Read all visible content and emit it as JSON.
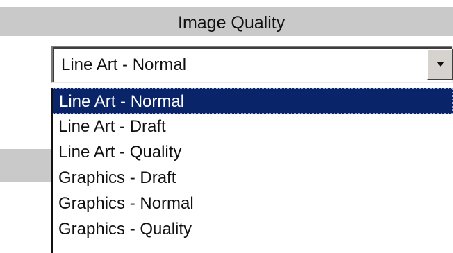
{
  "section": {
    "title": "Image Quality"
  },
  "select": {
    "value": "Line Art - Normal",
    "arrow_icon": "triangle-down-icon",
    "options": [
      {
        "label": "Line Art - Normal",
        "selected": true
      },
      {
        "label": "Line Art - Draft",
        "selected": false
      },
      {
        "label": "Line Art - Quality",
        "selected": false
      },
      {
        "label": "Graphics - Draft",
        "selected": false
      },
      {
        "label": "Graphics - Normal",
        "selected": false
      },
      {
        "label": "Graphics - Quality",
        "selected": false
      }
    ]
  },
  "colors": {
    "header_bg": "#c9c9c9",
    "selection_bg": "#0a246a",
    "selection_text": "#ffffff",
    "text": "#111111",
    "button_face": "#d6d3ce"
  }
}
